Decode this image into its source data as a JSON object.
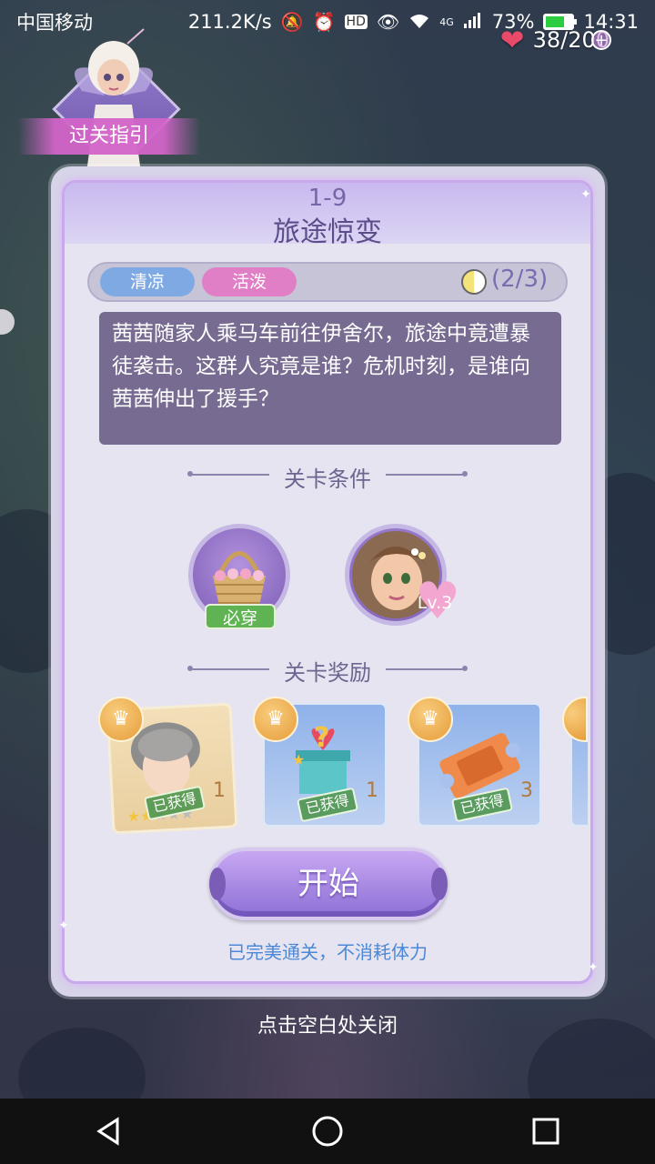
{
  "status_bar": {
    "carrier": "中国移动",
    "speed": "211.2K/s",
    "network": "4G",
    "battery": "73%",
    "battery_level": 0.73,
    "time": "14:31"
  },
  "energy": {
    "value": "38/200"
  },
  "guide": {
    "label": "过关指引"
  },
  "level": {
    "number": "1-9",
    "name": "旅途惊变",
    "tags": [
      "清凉",
      "活泼"
    ],
    "progress": "(2/3)",
    "story": "茜茜随家人乘马车前往伊舍尔，旅途中竟遭暴徒袭击。这群人究竟是谁？危机时刻，是谁向茜茜伸出了援手？"
  },
  "conditions": {
    "title": "关卡条件",
    "must_wear": "必穿",
    "character_level": "Lv.3"
  },
  "rewards": {
    "title": "关卡奖励",
    "items": [
      {
        "icon": "hair-clothing-icon",
        "status": "已获得",
        "qty": "1"
      },
      {
        "icon": "gift-box-icon",
        "status": "已获得",
        "qty": "1"
      },
      {
        "icon": "ticket-icon",
        "status": "已获得",
        "qty": "3"
      }
    ]
  },
  "start_button": "开始",
  "perfect_note": "已完美通关，不消耗体力",
  "close_hint": "点击空白处关闭",
  "colors": {
    "panel": "#e6e4f1",
    "accent": "#8c70d6",
    "story_bg": "#776b91",
    "tag_fresh": "#7fa9e3",
    "tag_lively": "#e07fc6"
  }
}
